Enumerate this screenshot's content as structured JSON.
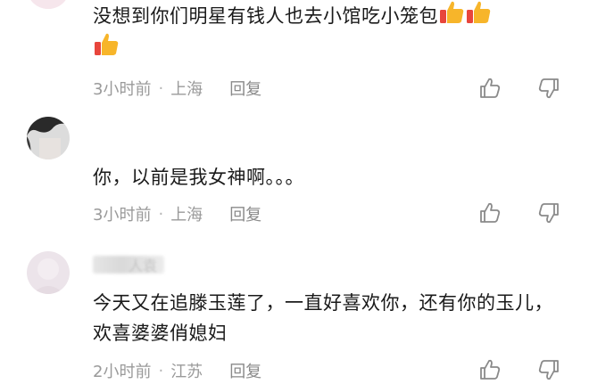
{
  "comments": [
    {
      "text": "没想到你们明星有钱人也去小馆吃小笼包",
      "emoji_after_text": [
        "thumbs-up-icon",
        "thumbs-up-icon",
        "thumbs-up-icon"
      ],
      "time": "3小时前",
      "location": "上海",
      "reply_label": "回复"
    },
    {
      "text": "你，以前是我女神啊。。。",
      "time": "3小时前",
      "location": "上海",
      "reply_label": "回复"
    },
    {
      "username": "人袁",
      "text": "今天又在追滕玉莲了，一直好喜欢你，还有你的玉儿，欢喜婆婆俏媳妇",
      "time": "2小时前",
      "location": "江苏",
      "reply_label": "回复"
    }
  ],
  "separator": "·",
  "colors": {
    "text_primary": "#1a1a1a",
    "text_meta": "#9a9a9a",
    "thumb_emoji": "#f7b52a",
    "thumb_cuff": "#e8453c"
  }
}
